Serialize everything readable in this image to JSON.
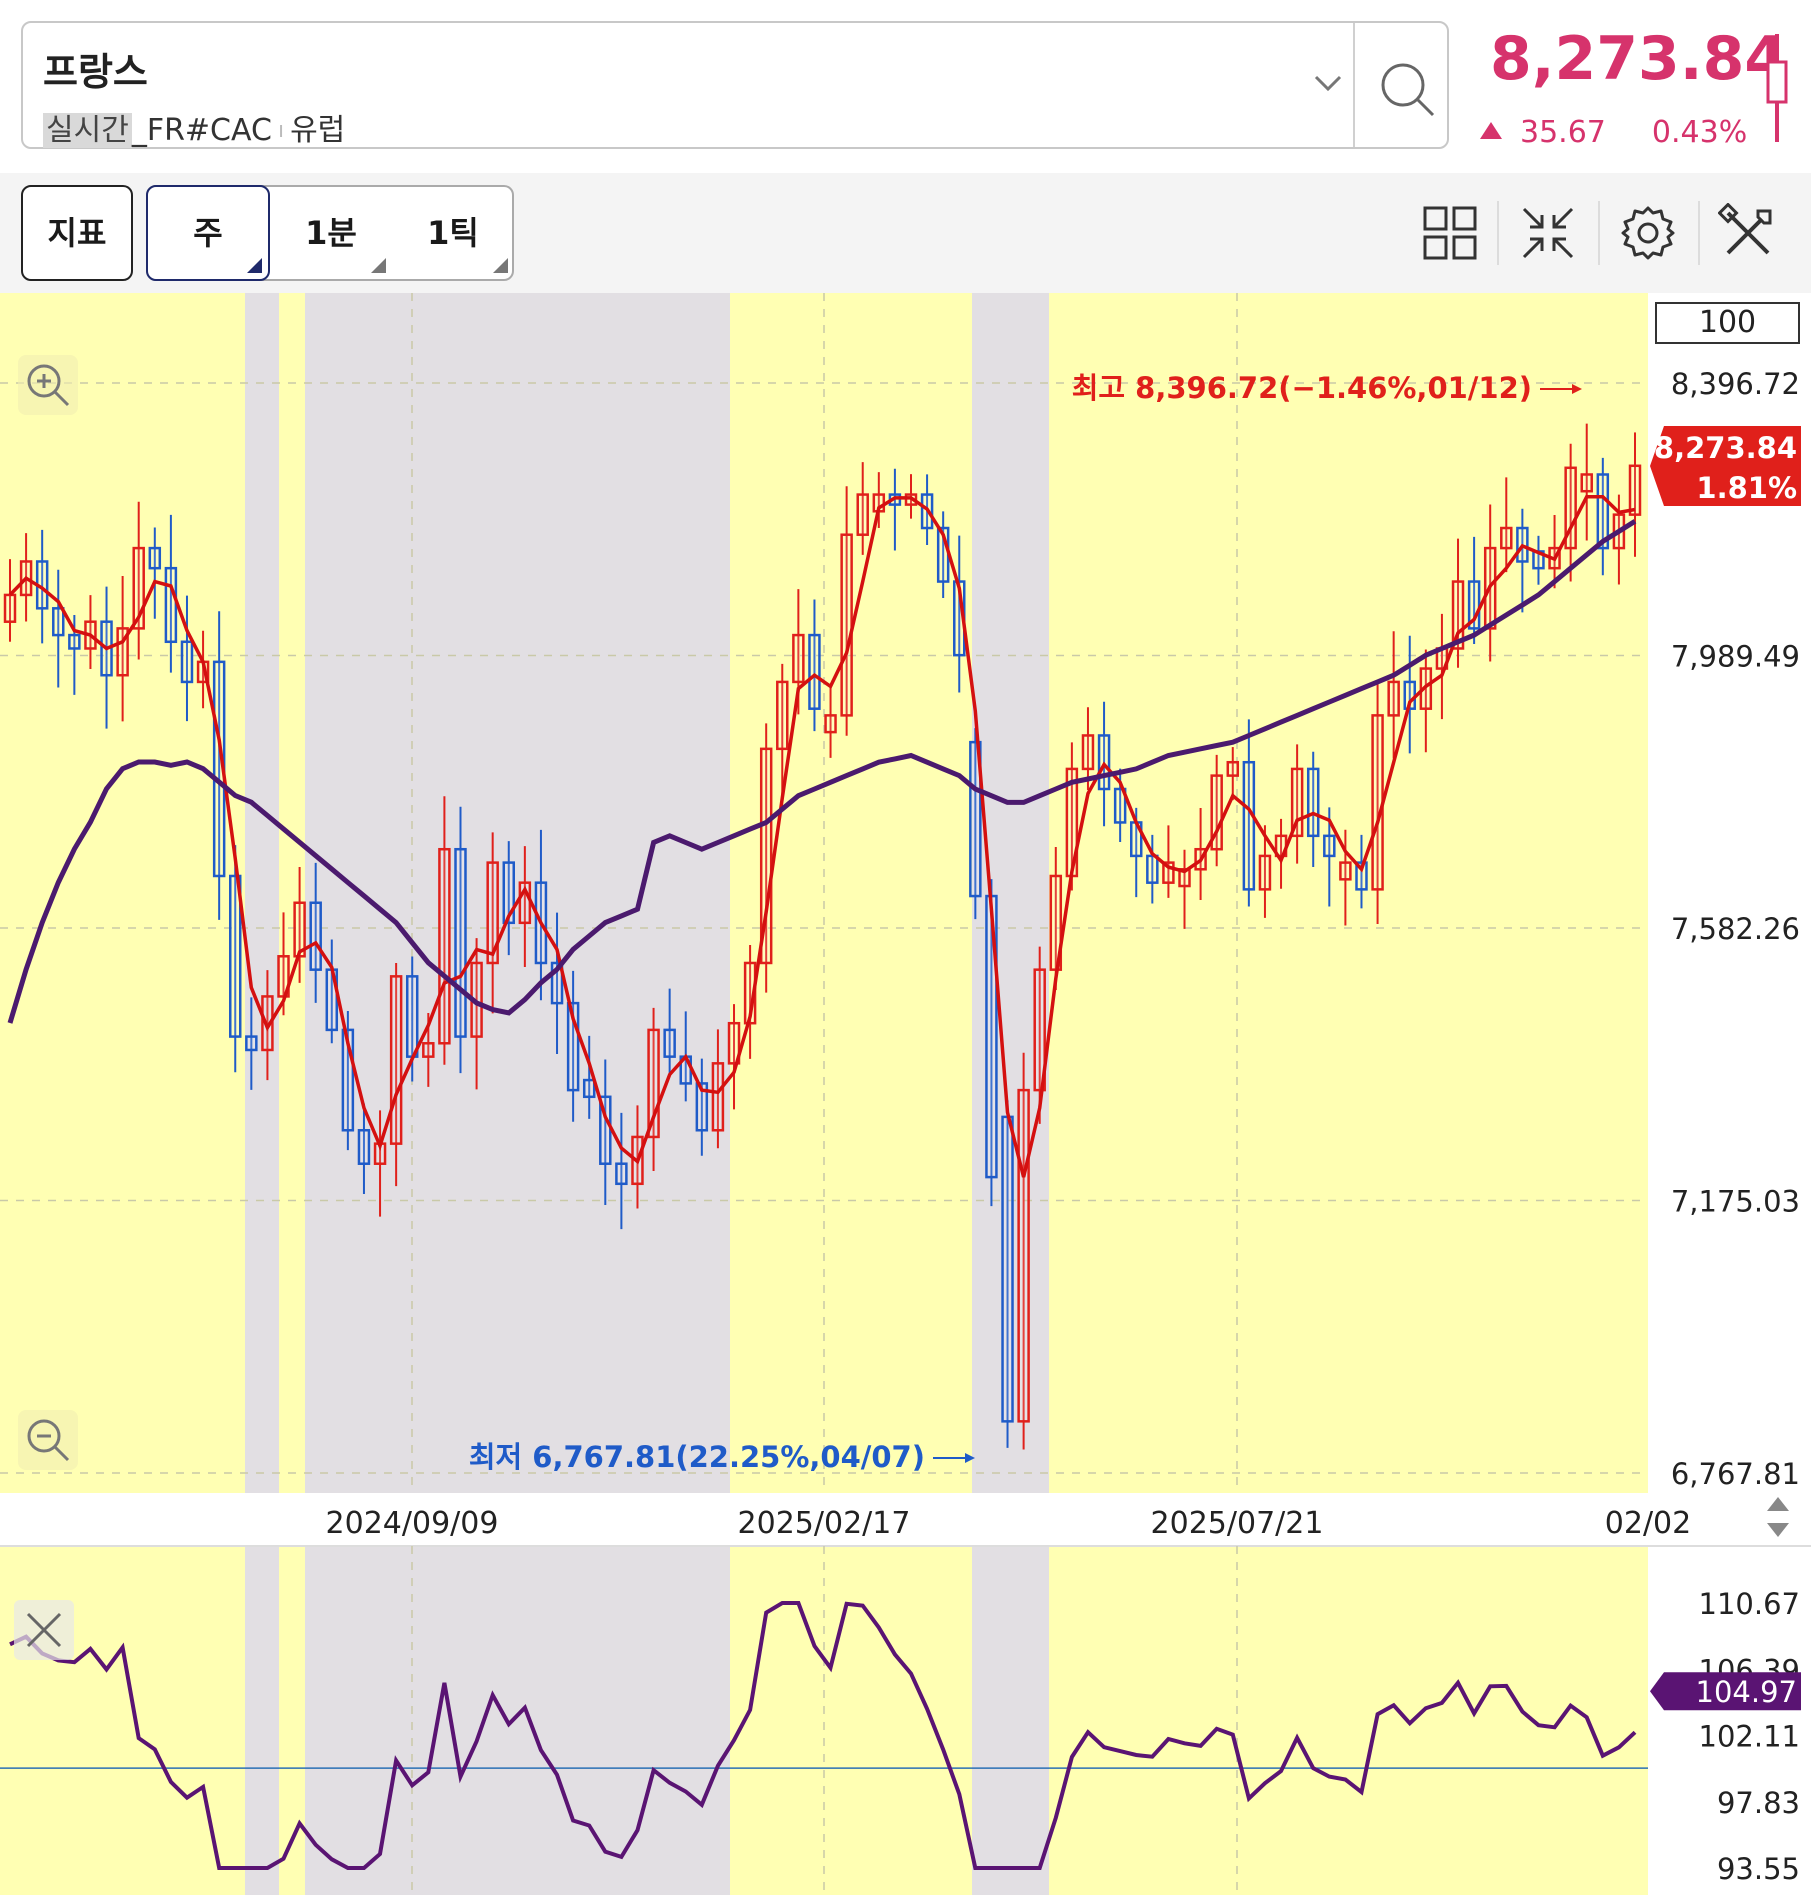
{
  "header": {
    "symbol_name": "프랑스",
    "realtime_badge": "실시간",
    "symbol_code": "_FR#CAC",
    "separator": "ı",
    "region": "유럽",
    "price": "8,273.84",
    "change": "35.67",
    "change_pct": "0.43%",
    "accent_color": "#d6336c"
  },
  "toolbar": {
    "indicator_label": "지표",
    "periods": [
      "주",
      "1분",
      "1틱"
    ],
    "selected_period": "주",
    "icons": [
      "grid-layout-icon",
      "collapse-icon",
      "settings-gear-icon",
      "tools-icon"
    ]
  },
  "chart": {
    "count_box": "100",
    "y_ticks": [
      "8,396.72",
      "7,989.49",
      "7,582.26",
      "7,175.03",
      "6,767.81"
    ],
    "x_ticks": [
      "2024/09/09",
      "2025/02/17",
      "2025/07/21",
      "02/02"
    ],
    "current_price_tag": "8,273.84",
    "current_pct_tag": "1.81%",
    "high_annotation": "최고 8,396.72(−1.46%,01/12)",
    "low_annotation": "최저 6,767.81(22.25%,04/07)",
    "up_color": "#e0201b",
    "down_color": "#1f5bc8",
    "ma_short_color": "#d41010",
    "ma_long_color": "#4b1a6e",
    "bg_yellow": "#ffffb3",
    "bg_gray": "#e2dfe3"
  },
  "indicator": {
    "y_ticks": [
      "110.67",
      "106.39",
      "102.11",
      "97.83",
      "93.55"
    ],
    "current_tag": "104.97",
    "tag_color": "#5a1473"
  },
  "chart_data": {
    "type": "candlestick",
    "series": [
      {
        "name": "price",
        "ylim": [
          6767.81,
          8396.72
        ]
      },
      {
        "name": "indicator",
        "ylim": [
          93.55,
          110.67
        ]
      }
    ]
  }
}
